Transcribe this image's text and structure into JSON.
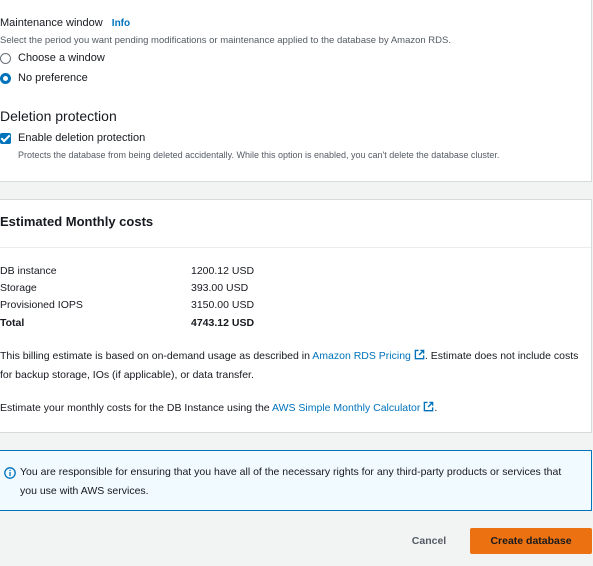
{
  "maintenance": {
    "label": "Maintenance window",
    "info": "Info",
    "description": "Select the period you want pending modifications or maintenance applied to the database by Amazon RDS.",
    "options": [
      {
        "label": "Choose a window",
        "selected": false
      },
      {
        "label": "No preference",
        "selected": true
      }
    ]
  },
  "deletion": {
    "title": "Deletion protection",
    "checkbox_label": "Enable deletion protection",
    "checked": true,
    "description": "Protects the database from being deleted accidentally. While this option is enabled, you can't delete the database cluster."
  },
  "costs": {
    "title": "Estimated Monthly costs",
    "rows": [
      {
        "label": "DB instance",
        "value": "1200.12 USD"
      },
      {
        "label": "Storage",
        "value": "393.00 USD"
      },
      {
        "label": "Provisioned IOPS",
        "value": "3150.00 USD"
      },
      {
        "label": "Total",
        "value": "4743.12 USD"
      }
    ],
    "billing_pre": "This billing estimate is based on on-demand usage as described in ",
    "billing_link": "Amazon RDS Pricing",
    "billing_post": ". Estimate does not include costs for backup storage, IOs (if applicable), or data transfer.",
    "calc_pre": "Estimate your monthly costs for the DB Instance using the ",
    "calc_link": "AWS Simple Monthly Calculator",
    "calc_post": "."
  },
  "alert": {
    "icon": "info-circle-icon",
    "text": "You are responsible for ensuring that you have all of the necessary rights for any third-party products or services that you use with AWS services."
  },
  "actions": {
    "cancel": "Cancel",
    "create": "Create database"
  },
  "colors": {
    "primary_button": "#ec7211",
    "link": "#0073bb",
    "alert_bg": "#f1faff"
  }
}
